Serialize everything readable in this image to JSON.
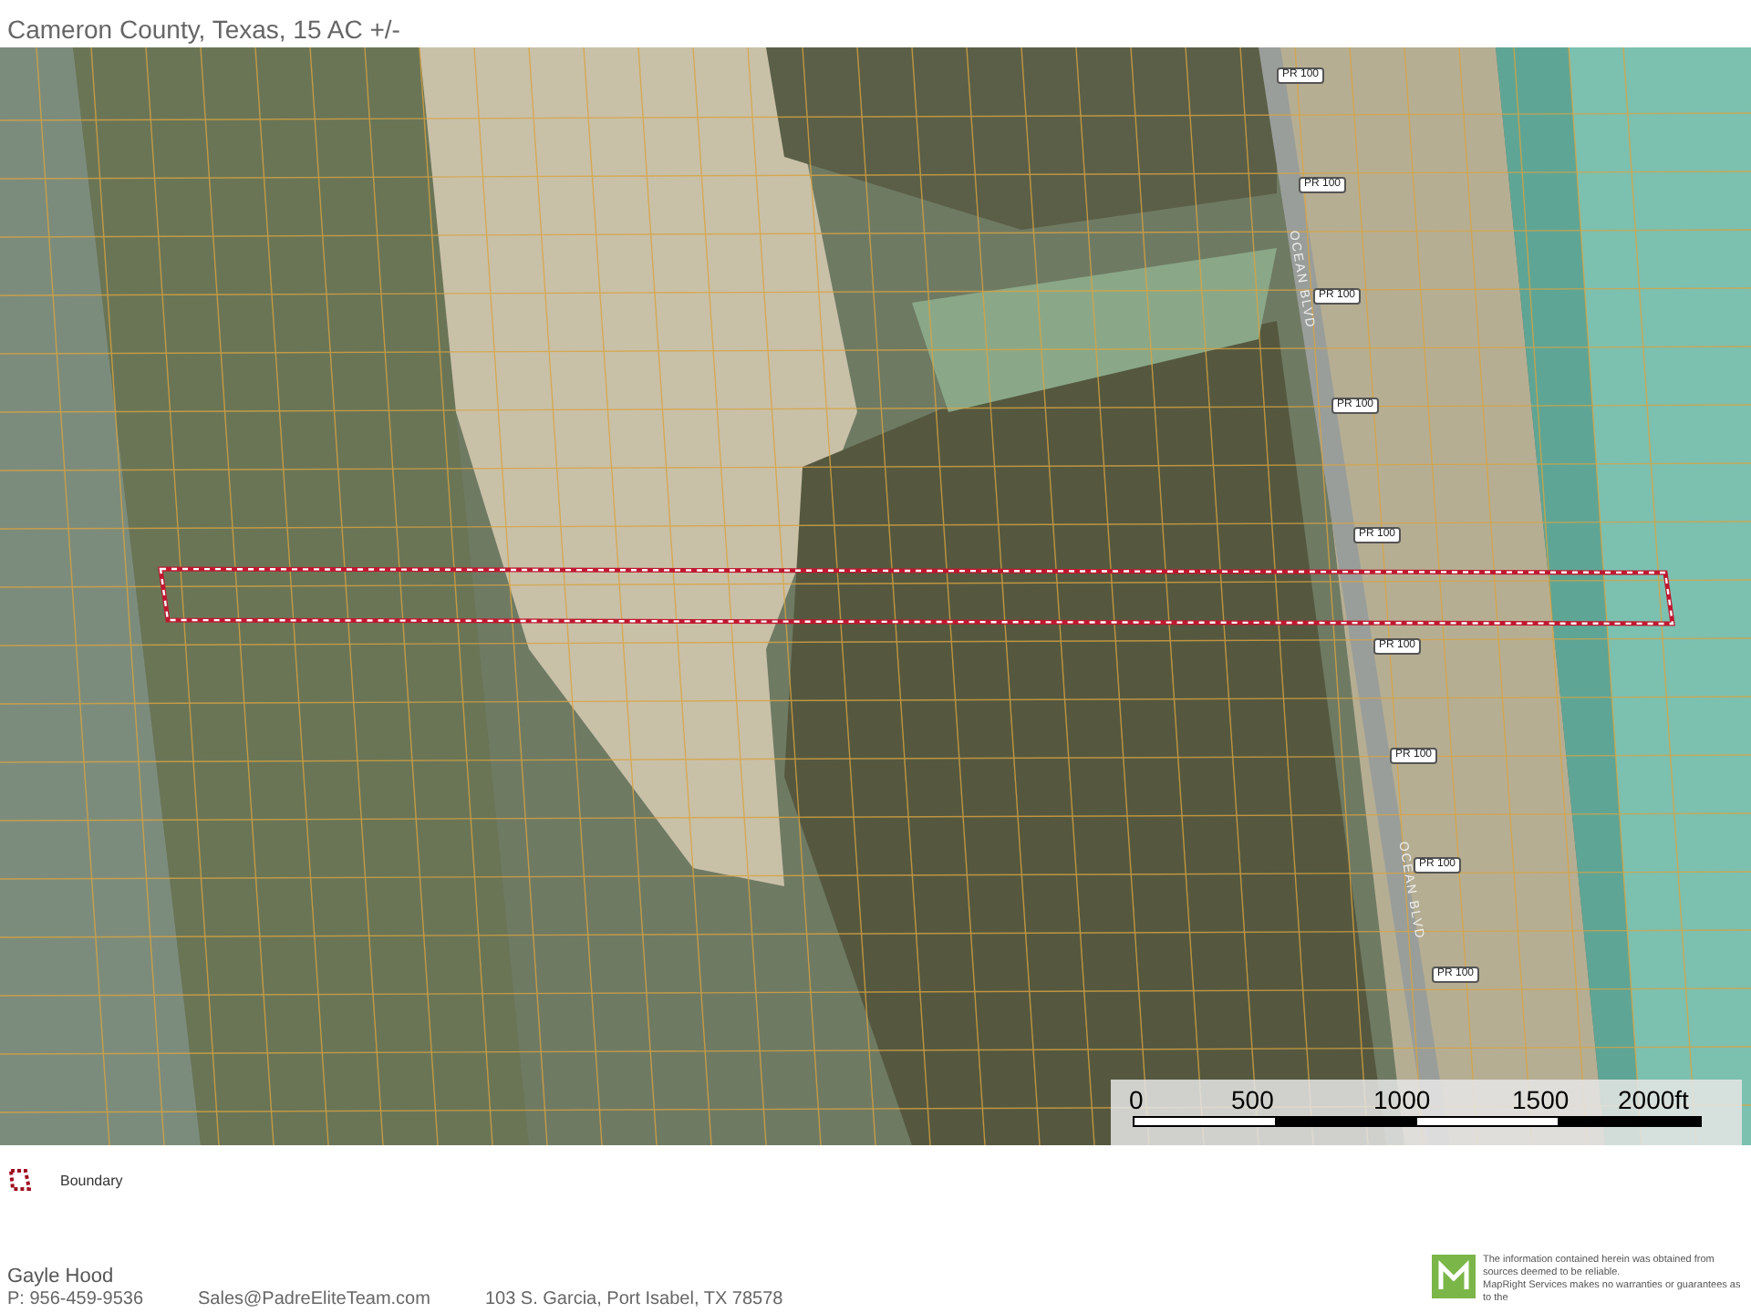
{
  "header": {
    "subtitle": "Cameron County, Texas, 15 AC +/-"
  },
  "map": {
    "road_labels": [
      {
        "kind": "shield",
        "text": "PR 100"
      },
      {
        "kind": "shield",
        "text": "PR 100"
      },
      {
        "kind": "shield",
        "text": "PR 100"
      },
      {
        "kind": "shield",
        "text": "PR 100"
      },
      {
        "kind": "shield",
        "text": "PR 100"
      },
      {
        "kind": "shield",
        "text": "PR 100"
      },
      {
        "kind": "shield",
        "text": "PR 100"
      },
      {
        "kind": "shield",
        "text": "PR 100"
      },
      {
        "kind": "shield",
        "text": "PR 100"
      },
      {
        "kind": "street",
        "text": "OCEAN BLVD"
      },
      {
        "kind": "street",
        "text": "OCEAN BLVD"
      }
    ],
    "scale_bar": {
      "ticks": [
        "0",
        "500",
        "1000",
        "1500",
        "2000ft"
      ]
    }
  },
  "legend": [
    {
      "label": "Boundary"
    }
  ],
  "footer": {
    "agent": "Gayle Hood",
    "phone": "P: 956-459-9536",
    "email": "Sales@PadreEliteTeam.com",
    "address": "103 S. Garcia, Port Isabel, TX 78578",
    "disclaimer": [
      "The information contained herein was obtained from sources deemed to be reliable.",
      "MapRight Services makes no warranties or guarantees as to the"
    ]
  }
}
